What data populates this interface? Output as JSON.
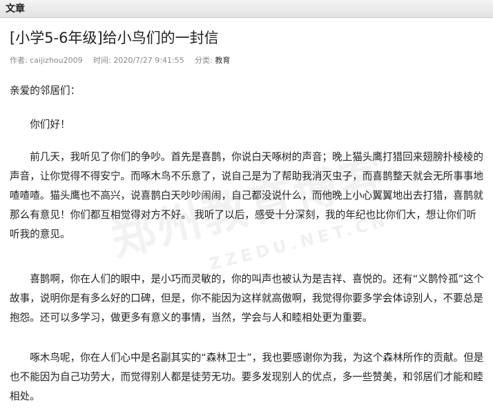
{
  "tab": {
    "label": "文章"
  },
  "article": {
    "title": "[小学5-6年级]给小鸟们的一封信",
    "meta": {
      "author_label": "作者:",
      "author": "caijizhou2009",
      "time_label": "时间:",
      "time": "2020/7/27 9:41:55",
      "category_label": "分类:",
      "category": "教育"
    },
    "paragraphs": [
      "亲爱的邻居们：",
      "你们好！",
      "前几天，我听见了你们的争吵。首先是喜鹊，你说白天啄树的声音；晚上猫头鹰打猎回来翅膀扑棱棱的声音，让你觉得不得安宁。而啄木鸟不乐意了，说自己是为了帮助我消灭虫子，而喜鹊整天就会无所事事地喳喳喳。猫头鹰也不高兴，说喜鹊白天吵吵闹闹，自己都没说什么，而他晚上小心翼翼地出去打猎，喜鹊就那么有意见！你们都互相觉得对方不好。 我听了以后，感受十分深刻，我的年纪也比你们大，想让你们听听我的意见。",
      "喜鹊啊，你在人们的眼中，是小巧而灵敏的，你的叫声也被认为是吉祥、喜悦的。还有“义鹊怜孤”这个故事，说明你是有多么好的口碑，但是，你不能因为这样就高傲啊，我觉得你要多学会体谅别人，不要总是抱怨。还可以多学习，做更多有意义的事情，当然，学会与人和睦相处更为重要。",
      "啄木鸟呢，你在人们心中是名副其实的“森林卫士”，我也要感谢你为我，为这个森林所作的贡献。但是也不能因为自己功劳大，而觉得别人都是徒劳无功。要多发现别人的优点，多一些赞美，和邻居们才能和睦相处。"
    ]
  },
  "watermark": {
    "text": "郑州教育博客",
    "url": "ZZEDU.NET.CN"
  }
}
